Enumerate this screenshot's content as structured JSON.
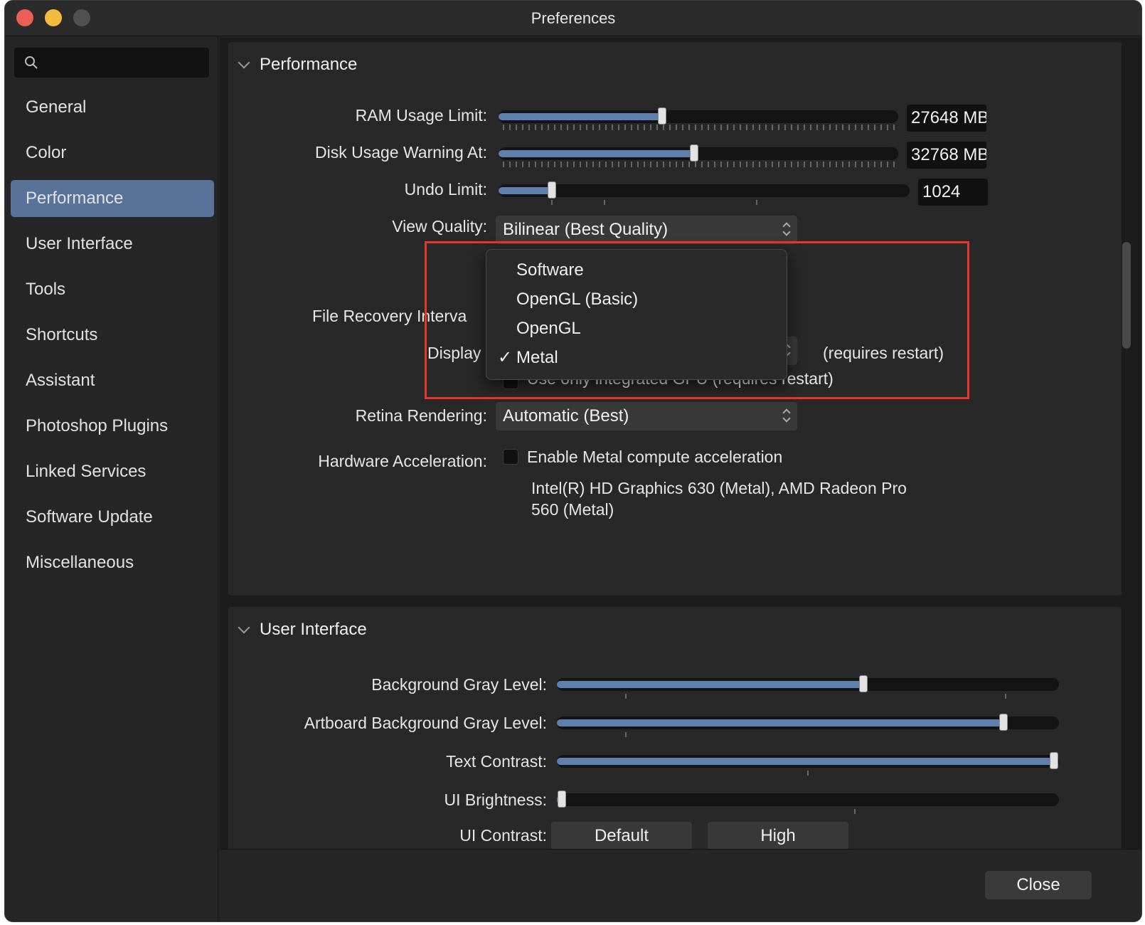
{
  "window": {
    "title": "Preferences"
  },
  "sidebar": {
    "search_placeholder": "",
    "items": [
      {
        "label": "General"
      },
      {
        "label": "Color"
      },
      {
        "label": "Performance",
        "active": true
      },
      {
        "label": "User Interface"
      },
      {
        "label": "Tools"
      },
      {
        "label": "Shortcuts"
      },
      {
        "label": "Assistant"
      },
      {
        "label": "Photoshop Plugins"
      },
      {
        "label": "Linked Services"
      },
      {
        "label": "Software Update"
      },
      {
        "label": "Miscellaneous"
      }
    ]
  },
  "performance": {
    "title": "Performance",
    "ram_label": "RAM Usage Limit:",
    "ram_value": "27648 MB",
    "ram_level": 0.41,
    "disk_label": "Disk Usage Warning At:",
    "disk_value": "32768 MB",
    "disk_level": 0.49,
    "undo_label": "Undo Limit:",
    "undo_value": "1024",
    "undo_level": 0.13,
    "view_quality_label": "View Quality:",
    "view_quality_value": "Bilinear (Best Quality)",
    "file_recovery_label": "File Recovery Interva",
    "display_label": "Display",
    "display_note": "(requires restart)",
    "integrated_gpu_label": "Use only integrated GPU (requires restart)",
    "retina_label": "Retina Rendering:",
    "retina_value": "Automatic (Best)",
    "hw_accel_label": "Hardware Acceleration:",
    "hw_accel_checkbox_label": "Enable Metal compute acceleration",
    "gpu_info_line1": "Intel(R) HD Graphics 630 (Metal), AMD Radeon Pro",
    "gpu_info_line2": "560 (Metal)"
  },
  "display_dropdown": {
    "options": [
      {
        "label": "Software",
        "checked": false
      },
      {
        "label": "OpenGL (Basic)",
        "checked": false
      },
      {
        "label": "OpenGL",
        "checked": false
      },
      {
        "label": "Metal",
        "checked": true
      }
    ],
    "check_glyph": "✓"
  },
  "user_interface": {
    "title": "User Interface",
    "bg_gray_label": "Background Gray Level:",
    "bg_gray_level": 0.61,
    "artboard_gray_label": "Artboard Background Gray Level:",
    "artboard_gray_level": 0.89,
    "text_contrast_label": "Text Contrast:",
    "text_contrast_level": 0.99,
    "ui_brightness_label": "UI Brightness:",
    "ui_brightness_level": 0.01,
    "ui_contrast_label": "UI Contrast:",
    "ui_contrast_options": [
      "Default",
      "High"
    ]
  },
  "footer": {
    "close_label": "Close"
  },
  "colors": {
    "accent": "#58729a",
    "slider_fill": "#5f7fad",
    "highlight": "#e5382a"
  }
}
